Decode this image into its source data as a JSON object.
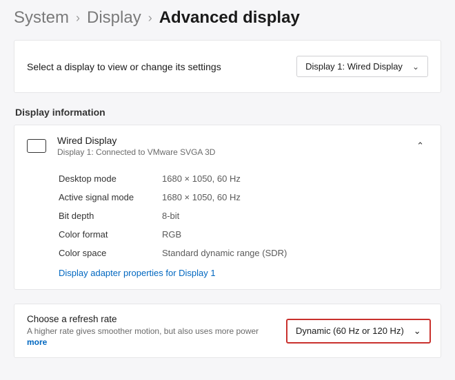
{
  "breadcrumb": {
    "system": "System",
    "display": "Display",
    "current": "Advanced display"
  },
  "selectDisplay": {
    "prompt": "Select a display to view or change its settings",
    "dropdownValue": "Display 1: Wired Display"
  },
  "displayInfo": {
    "sectionTitle": "Display information",
    "name": "Wired Display",
    "sub": "Display 1: Connected to VMware SVGA 3D",
    "rows": [
      {
        "label": "Desktop mode",
        "value": "1680 × 1050, 60 Hz"
      },
      {
        "label": "Active signal mode",
        "value": "1680 × 1050, 60 Hz"
      },
      {
        "label": "Bit depth",
        "value": "8-bit"
      },
      {
        "label": "Color format",
        "value": "RGB"
      },
      {
        "label": "Color space",
        "value": "Standard dynamic range (SDR)"
      }
    ],
    "adapterLink": "Display adapter properties for Display 1"
  },
  "refreshRate": {
    "title": "Choose a refresh rate",
    "desc": "A higher rate gives smoother motion, but also uses more power",
    "more": "more",
    "dropdownValue": "Dynamic (60 Hz or 120 Hz)"
  }
}
